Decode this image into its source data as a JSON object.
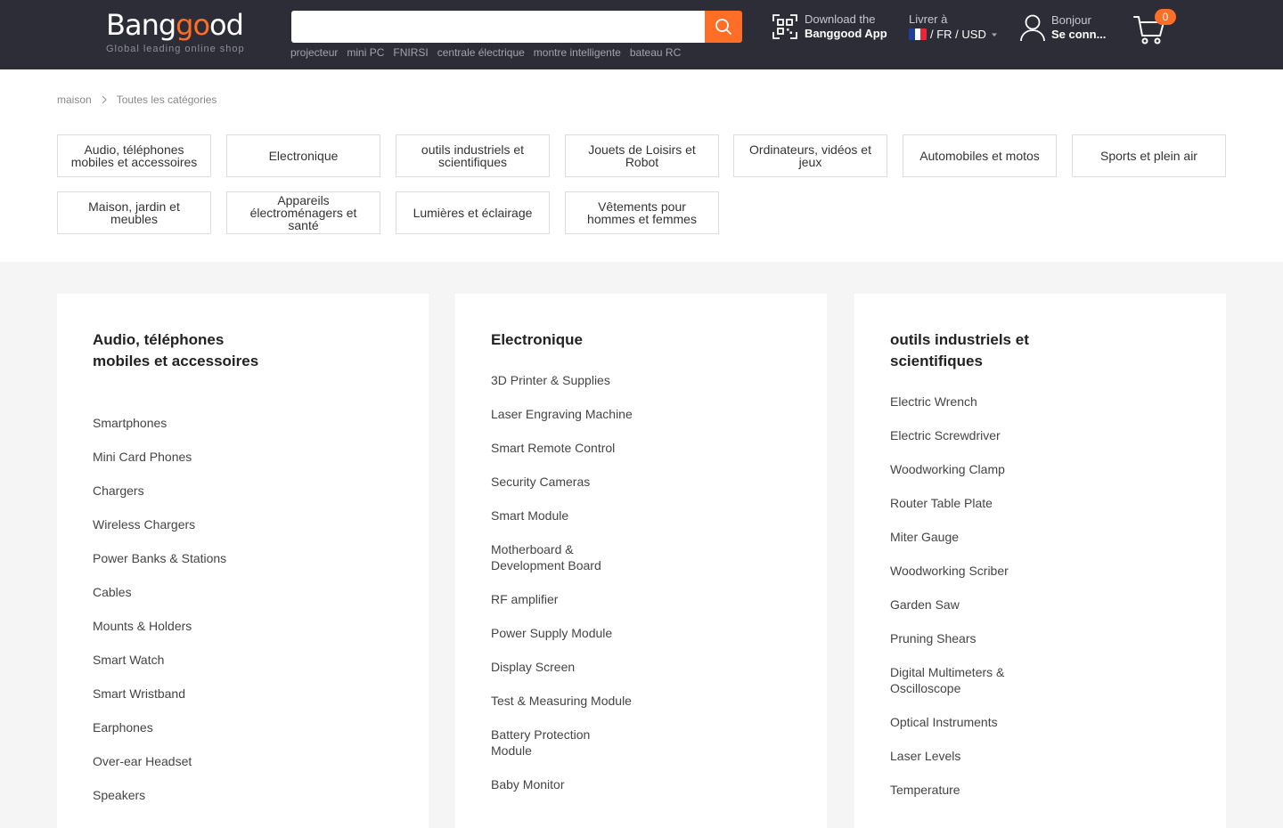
{
  "header": {
    "logo_text": "Banggood",
    "logo_tagline": "Global leading online shop",
    "search_placeholder": "",
    "hot_words": [
      "projecteur",
      "mini PC",
      "FNIRSI",
      "centrale électrique",
      "montre intelligente",
      "bateau RC"
    ],
    "app_line1": "Download the",
    "app_line2": "Banggood App",
    "ship_label": "Livrer à",
    "ship_value": "/ FR / USD",
    "account_line1": "Bonjour",
    "account_line2": "Se conn...",
    "cart_count": "0",
    "accent_color": "#ff6e26"
  },
  "breadcrumb": [
    "maison",
    "Toutes les catégories"
  ],
  "categories": [
    "Audio, téléphones mobiles et accessoires",
    "Electronique",
    "outils industriels et scientifiques",
    "Jouets de Loisirs et Robot",
    "Ordinateurs, vidéos et jeux",
    "Automobiles et motos",
    "Sports et plein air",
    "Maison, jardin et meubles",
    "Appareils électroménagers et santé",
    "Lumières et éclairage",
    "Vêtements pour hommes et femmes"
  ],
  "columns": [
    {
      "title": "Audio, téléphones mobiles et accessoires",
      "items": [
        "Smartphones",
        "Mini Card Phones",
        "Chargers",
        "Wireless Chargers",
        "Power Banks & Stations",
        "Cables",
        "Mounts & Holders",
        "Smart Watch",
        "Smart Wristband",
        "Earphones",
        "Over-ear Headset",
        "Speakers"
      ]
    },
    {
      "title": "Electronique",
      "items": [
        "3D Printer & Supplies",
        "Laser Engraving Machine",
        "Smart Remote Control",
        "Security Cameras",
        "Smart Module",
        "Motherboard & Development Board",
        "RF amplifier",
        "Power Supply Module",
        "Display Screen",
        "Test & Measuring Module",
        "Battery Protection Module",
        "Baby Monitor"
      ]
    },
    {
      "title": "outils industriels et scientifiques",
      "items": [
        "Electric Wrench",
        "Electric Screwdriver",
        "Woodworking Clamp",
        "Router Table Plate",
        "Miter Gauge",
        "Woodworking Scriber",
        "Garden Saw",
        "Pruning Shears",
        "Digital Multimeters & Oscilloscope",
        "Optical Instruments",
        "Laser Levels",
        "Temperature"
      ]
    }
  ]
}
